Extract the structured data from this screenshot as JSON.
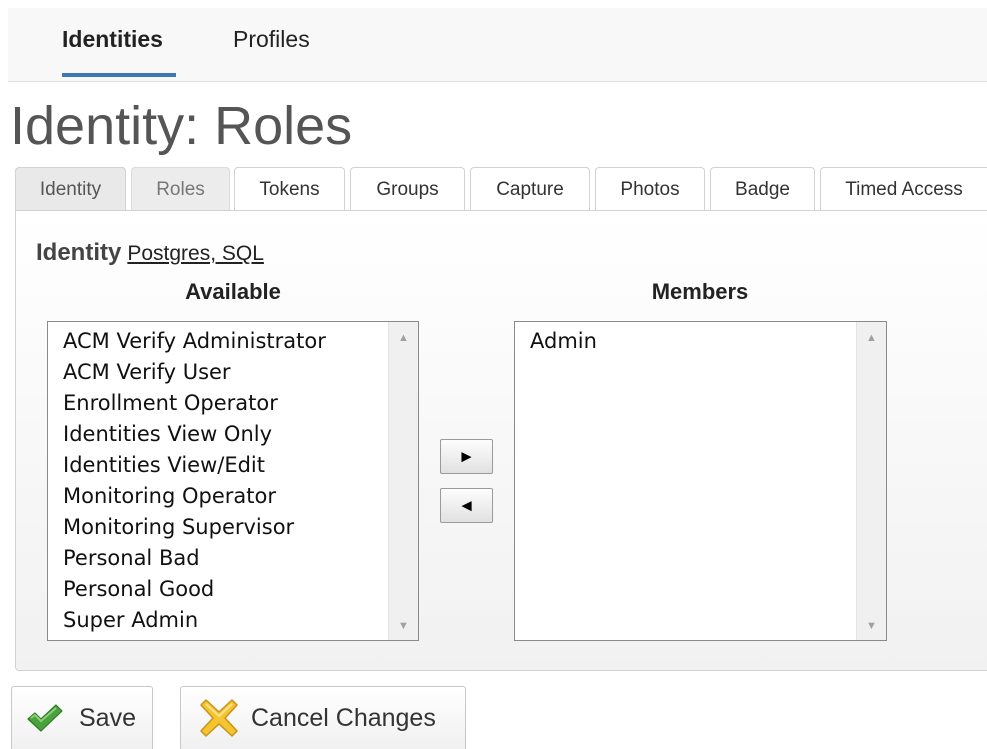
{
  "nav": {
    "items": [
      {
        "label": "Identities",
        "active": true
      },
      {
        "label": "Profiles",
        "active": false
      }
    ],
    "accent_color": "#3d78b4"
  },
  "page": {
    "title": "Identity: Roles"
  },
  "tabs": [
    {
      "label": "Identity",
      "state": "muted"
    },
    {
      "label": "Roles",
      "state": "selected"
    },
    {
      "label": "Tokens",
      "state": "normal"
    },
    {
      "label": "Groups",
      "state": "normal"
    },
    {
      "label": "Capture",
      "state": "normal"
    },
    {
      "label": "Photos",
      "state": "normal"
    },
    {
      "label": "Badge",
      "state": "normal"
    },
    {
      "label": "Timed Access",
      "state": "normal"
    }
  ],
  "identity": {
    "label": "Identity",
    "name": "Postgres, SQL"
  },
  "available": {
    "heading": "Available",
    "items": [
      "ACM Verify Administrator",
      "ACM Verify User",
      "Enrollment Operator",
      "Identities View Only",
      "Identities View/Edit",
      "Monitoring Operator",
      "Monitoring Supervisor",
      "Personal Bad",
      "Personal Good",
      "Super Admin"
    ]
  },
  "members": {
    "heading": "Members",
    "items": [
      "Admin"
    ]
  },
  "move_buttons": {
    "add_glyph": "►",
    "remove_glyph": "◄"
  },
  "actions": {
    "save_label": "Save",
    "save_icon": "checkmark-icon",
    "cancel_label": "Cancel Changes",
    "cancel_icon": "cancel-x-icon"
  }
}
